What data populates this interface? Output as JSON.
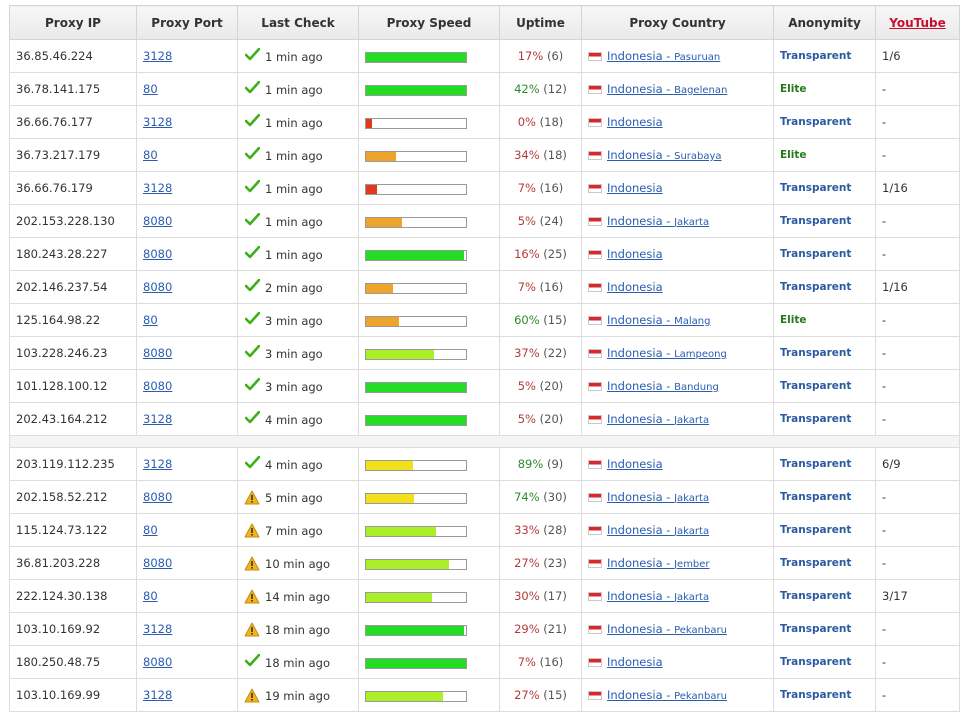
{
  "headers": {
    "ip": "Proxy IP",
    "port": "Proxy Port",
    "last_check": "Last Check",
    "speed": "Proxy Speed",
    "uptime": "Uptime",
    "country": "Proxy Country",
    "anonymity": "Anonymity",
    "youtube": "YouTube"
  },
  "colors": {
    "speed_green": "#22dd22",
    "speed_lime": "#aaef28",
    "speed_yellow": "#f2e11a",
    "speed_orange": "#eea42a",
    "speed_red": "#e03a1e",
    "uptime_red": "#b23c3c",
    "uptime_green": "#2e8b2e",
    "link": "#2a5db0",
    "transparent": "#2c5aa0",
    "elite": "#267a1b",
    "youtube_header": "#c8102e"
  },
  "rows": [
    {
      "ip": "36.85.46.224",
      "port": "3128",
      "status_icon": "checkmark-icon",
      "last_check": "1 min ago",
      "speed": 1.0,
      "speed_color": "green",
      "uptime_pct": "17%",
      "uptime_count": "(6)",
      "uptime_good": false,
      "country": "Indonesia",
      "city": "Pasuruan",
      "anonymity": "Transparent",
      "youtube": "1/6"
    },
    {
      "ip": "36.78.141.175",
      "port": "80",
      "status_icon": "checkmark-icon",
      "last_check": "1 min ago",
      "speed": 1.0,
      "speed_color": "green",
      "uptime_pct": "42%",
      "uptime_count": "(12)",
      "uptime_good": true,
      "country": "Indonesia",
      "city": "Bagelenan",
      "anonymity": "Elite",
      "youtube": "-"
    },
    {
      "ip": "36.66.76.177",
      "port": "3128",
      "status_icon": "checkmark-icon",
      "last_check": "1 min ago",
      "speed": 0.06,
      "speed_color": "red",
      "uptime_pct": "0%",
      "uptime_count": "(18)",
      "uptime_good": false,
      "country": "Indonesia",
      "city": "",
      "anonymity": "Transparent",
      "youtube": "-"
    },
    {
      "ip": "36.73.217.179",
      "port": "80",
      "status_icon": "checkmark-icon",
      "last_check": "1 min ago",
      "speed": 0.3,
      "speed_color": "orange",
      "uptime_pct": "34%",
      "uptime_count": "(18)",
      "uptime_good": false,
      "country": "Indonesia",
      "city": "Surabaya",
      "anonymity": "Elite",
      "youtube": "-"
    },
    {
      "ip": "36.66.76.179",
      "port": "3128",
      "status_icon": "checkmark-icon",
      "last_check": "1 min ago",
      "speed": 0.11,
      "speed_color": "red",
      "uptime_pct": "7%",
      "uptime_count": "(16)",
      "uptime_good": false,
      "country": "Indonesia",
      "city": "",
      "anonymity": "Transparent",
      "youtube": "1/16"
    },
    {
      "ip": "202.153.228.130",
      "port": "8080",
      "status_icon": "checkmark-icon",
      "last_check": "1 min ago",
      "speed": 0.36,
      "speed_color": "orange",
      "uptime_pct": "5%",
      "uptime_count": "(24)",
      "uptime_good": false,
      "country": "Indonesia",
      "city": "Jakarta",
      "anonymity": "Transparent",
      "youtube": "-"
    },
    {
      "ip": "180.243.28.227",
      "port": "8080",
      "status_icon": "checkmark-icon",
      "last_check": "1 min ago",
      "speed": 0.98,
      "speed_color": "green",
      "uptime_pct": "16%",
      "uptime_count": "(25)",
      "uptime_good": false,
      "country": "Indonesia",
      "city": "",
      "anonymity": "Transparent",
      "youtube": "-"
    },
    {
      "ip": "202.146.237.54",
      "port": "8080",
      "status_icon": "checkmark-icon",
      "last_check": "2 min ago",
      "speed": 0.27,
      "speed_color": "orange",
      "uptime_pct": "7%",
      "uptime_count": "(16)",
      "uptime_good": false,
      "country": "Indonesia",
      "city": "",
      "anonymity": "Transparent",
      "youtube": "1/16"
    },
    {
      "ip": "125.164.98.22",
      "port": "80",
      "status_icon": "checkmark-icon",
      "last_check": "3 min ago",
      "speed": 0.33,
      "speed_color": "orange",
      "uptime_pct": "60%",
      "uptime_count": "(15)",
      "uptime_good": true,
      "country": "Indonesia",
      "city": "Malang",
      "anonymity": "Elite",
      "youtube": "-"
    },
    {
      "ip": "103.228.246.23",
      "port": "8080",
      "status_icon": "checkmark-icon",
      "last_check": "3 min ago",
      "speed": 0.68,
      "speed_color": "lime",
      "uptime_pct": "37%",
      "uptime_count": "(22)",
      "uptime_good": false,
      "country": "Indonesia",
      "city": "Lampeong",
      "anonymity": "Transparent",
      "youtube": "-"
    },
    {
      "ip": "101.128.100.12",
      "port": "8080",
      "status_icon": "checkmark-icon",
      "last_check": "3 min ago",
      "speed": 1.0,
      "speed_color": "green",
      "uptime_pct": "5%",
      "uptime_count": "(20)",
      "uptime_good": false,
      "country": "Indonesia",
      "city": "Bandung",
      "anonymity": "Transparent",
      "youtube": "-"
    },
    {
      "ip": "202.43.164.212",
      "port": "3128",
      "status_icon": "checkmark-icon",
      "last_check": "4 min ago",
      "speed": 1.0,
      "speed_color": "green",
      "uptime_pct": "5%",
      "uptime_count": "(20)",
      "uptime_good": false,
      "country": "Indonesia",
      "city": "Jakarta",
      "anonymity": "Transparent",
      "youtube": "-"
    },
    {
      "separator": true
    },
    {
      "ip": "203.119.112.235",
      "port": "3128",
      "status_icon": "checkmark-icon",
      "last_check": "4 min ago",
      "speed": 0.47,
      "speed_color": "yellow",
      "uptime_pct": "89%",
      "uptime_count": "(9)",
      "uptime_good": true,
      "country": "Indonesia",
      "city": "",
      "anonymity": "Transparent",
      "youtube": "6/9"
    },
    {
      "ip": "202.158.52.212",
      "port": "8080",
      "status_icon": "warning-icon",
      "last_check": "5 min ago",
      "speed": 0.48,
      "speed_color": "yellow",
      "uptime_pct": "74%",
      "uptime_count": "(30)",
      "uptime_good": true,
      "country": "Indonesia",
      "city": "Jakarta",
      "anonymity": "Transparent",
      "youtube": "-"
    },
    {
      "ip": "115.124.73.122",
      "port": "80",
      "status_icon": "warning-icon",
      "last_check": "7 min ago",
      "speed": 0.7,
      "speed_color": "lime",
      "uptime_pct": "33%",
      "uptime_count": "(28)",
      "uptime_good": false,
      "country": "Indonesia",
      "city": "Jakarta",
      "anonymity": "Transparent",
      "youtube": "-"
    },
    {
      "ip": "36.81.203.228",
      "port": "8080",
      "status_icon": "warning-icon",
      "last_check": "10 min ago",
      "speed": 0.83,
      "speed_color": "lime",
      "uptime_pct": "27%",
      "uptime_count": "(23)",
      "uptime_good": false,
      "country": "Indonesia",
      "city": "Jember",
      "anonymity": "Transparent",
      "youtube": "-"
    },
    {
      "ip": "222.124.30.138",
      "port": "80",
      "status_icon": "warning-icon",
      "last_check": "14 min ago",
      "speed": 0.66,
      "speed_color": "lime",
      "uptime_pct": "30%",
      "uptime_count": "(17)",
      "uptime_good": false,
      "country": "Indonesia",
      "city": "Jakarta",
      "anonymity": "Transparent",
      "youtube": "3/17"
    },
    {
      "ip": "103.10.169.92",
      "port": "3128",
      "status_icon": "warning-icon",
      "last_check": "18 min ago",
      "speed": 0.98,
      "speed_color": "green",
      "uptime_pct": "29%",
      "uptime_count": "(21)",
      "uptime_good": false,
      "country": "Indonesia",
      "city": "Pekanbaru",
      "anonymity": "Transparent",
      "youtube": "-"
    },
    {
      "ip": "180.250.48.75",
      "port": "8080",
      "status_icon": "checkmark-icon",
      "last_check": "18 min ago",
      "speed": 1.0,
      "speed_color": "green",
      "uptime_pct": "7%",
      "uptime_count": "(16)",
      "uptime_good": false,
      "country": "Indonesia",
      "city": "",
      "anonymity": "Transparent",
      "youtube": "-"
    },
    {
      "ip": "103.10.169.99",
      "port": "3128",
      "status_icon": "warning-icon",
      "last_check": "19 min ago",
      "speed": 0.77,
      "speed_color": "lime",
      "uptime_pct": "27%",
      "uptime_count": "(15)",
      "uptime_good": false,
      "country": "Indonesia",
      "city": "Pekanbaru",
      "anonymity": "Transparent",
      "youtube": "-"
    }
  ]
}
